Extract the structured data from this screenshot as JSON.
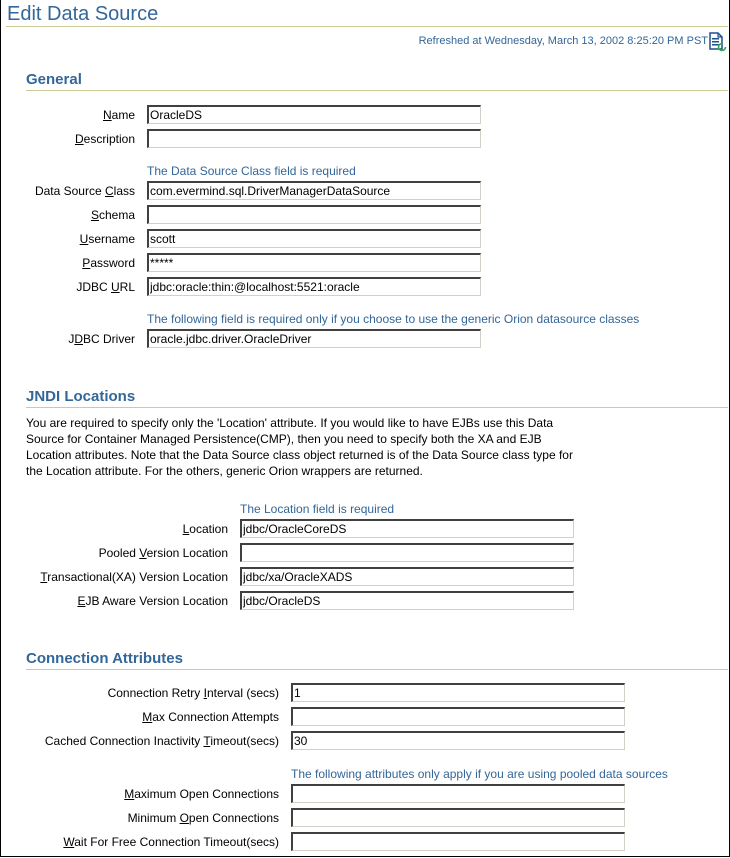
{
  "header": {
    "title": "Edit Data Source",
    "refreshed_text": "Refreshed at Wednesday, March 13, 2002 8:25:20 PM PST",
    "refresh_icon": "refresh-page-icon"
  },
  "general": {
    "heading": "General",
    "name": {
      "label_pre": "",
      "label_key": "N",
      "label_post": "ame",
      "value": "OracleDS"
    },
    "description": {
      "label_pre": "",
      "label_key": "D",
      "label_post": "escription",
      "value": ""
    },
    "dsclass_hint": "The Data Source Class field is required",
    "dsclass": {
      "label_pre": "Data Source ",
      "label_key": "C",
      "label_post": "lass",
      "value": "com.evermind.sql.DriverManagerDataSource"
    },
    "schema": {
      "label_pre": "",
      "label_key": "S",
      "label_post": "chema",
      "value": ""
    },
    "username": {
      "label_pre": "",
      "label_key": "U",
      "label_post": "sername",
      "value": "scott"
    },
    "password": {
      "label_pre": "",
      "label_key": "P",
      "label_post": "assword",
      "value": "*****"
    },
    "jdbc_url": {
      "label_pre": "JDBC ",
      "label_key": "U",
      "label_post": "RL",
      "value": "jdbc:oracle:thin:@localhost:5521:oracle"
    },
    "driver_hint": "The following field is required only if you choose to use the generic Orion datasource classes",
    "jdbc_driver": {
      "label_pre": "J",
      "label_key": "D",
      "label_post": "BC Driver",
      "value": "oracle.jdbc.driver.OracleDriver"
    }
  },
  "jndi": {
    "heading": "JNDI Locations",
    "description": "You are required to specify only the 'Location' attribute. If you would like to have EJBs use this Data Source for Container Managed Persistence(CMP), then you need to specify both the XA and EJB Location attributes. Note that the Data Source class object returned is of the Data Source class type for the Location attribute. For the others, generic Orion wrappers are returned.",
    "location_hint": "The Location field is required",
    "location": {
      "label_pre": "",
      "label_key": "L",
      "label_post": "ocation",
      "value": "jdbc/OracleCoreDS"
    },
    "pooled": {
      "label_pre": "Pooled ",
      "label_key": "V",
      "label_post": "ersion Location",
      "value": ""
    },
    "xa": {
      "label_pre": "",
      "label_key": "T",
      "label_post": "ransactional(XA) Version Location",
      "value": "jdbc/xa/OracleXADS"
    },
    "ejb": {
      "label_pre": "",
      "label_key": "E",
      "label_post": "JB Aware Version Location",
      "value": "jdbc/OracleDS"
    }
  },
  "connection": {
    "heading": "Connection Attributes",
    "retry": {
      "label_pre": "Connection Retry ",
      "label_key": "I",
      "label_post": "nterval (secs)",
      "value": "1"
    },
    "max_attempts": {
      "label_pre": "",
      "label_key": "M",
      "label_post": "ax Connection Attempts",
      "value": ""
    },
    "inactivity": {
      "label_pre": "Cached Connection Inactivity ",
      "label_key": "T",
      "label_post": "imeout(secs)",
      "value": "30"
    },
    "pooled_hint": "The following attributes only apply if you are using pooled data sources",
    "max_open": {
      "label_pre": "",
      "label_key": "M",
      "label_post": "aximum Open Connections",
      "value": ""
    },
    "min_open": {
      "label_pre": "Minimum ",
      "label_key": "O",
      "label_post": "pen Connections",
      "value": ""
    },
    "wait_timeout": {
      "label_pre": "",
      "label_key": "W",
      "label_post": "ait For Free Connection Timeout(secs)",
      "value": ""
    }
  }
}
